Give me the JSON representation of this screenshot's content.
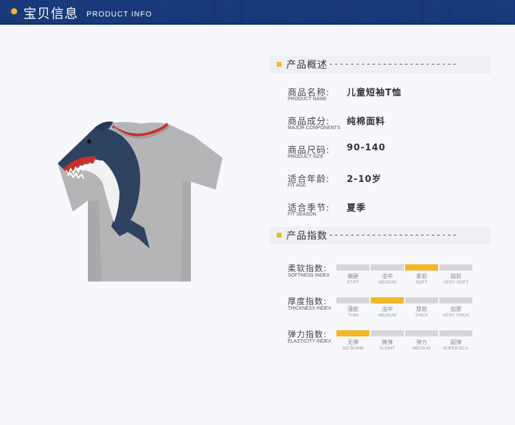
{
  "header": {
    "title": "宝贝信息",
    "subtitle": "PRODUCT INFO"
  },
  "colors": {
    "header_bg": "#14367a",
    "accent": "#f5b525",
    "shirt": "#b4b4b6",
    "shark": "#2e4360"
  },
  "overview": {
    "title": "产品概述",
    "dashes": "------------------------",
    "rows": [
      {
        "label": "商品名称:",
        "sub": "PRODUCT NAME",
        "value": "儿童短袖T恤"
      },
      {
        "label": "商品成分:",
        "sub": "MAJOR COMPONENTS",
        "value": "纯棉面料"
      },
      {
        "label": "商品尺码:",
        "sub": "PRODUCT SIZE",
        "value": "90-140"
      },
      {
        "label": "适合年龄:",
        "sub": "FIT AGE",
        "value": "2-10岁"
      },
      {
        "label": "适合季节:",
        "sub": "FIT SEASON",
        "value": "夏季"
      }
    ]
  },
  "indices": {
    "title": "产品指数",
    "dashes": "------------------------",
    "rows": [
      {
        "label": "柔软指数:",
        "sub": "SOFTNESS INDEX",
        "selected": 2,
        "options": [
          {
            "cn": "偏硬",
            "en": "STIFF"
          },
          {
            "cn": "适中",
            "en": "MEDIUM"
          },
          {
            "cn": "柔软",
            "en": "SOFT"
          },
          {
            "cn": "超软",
            "en": "VERY SOFT"
          }
        ]
      },
      {
        "label": "厚度指数:",
        "sub": "THICKNESS INDEX",
        "selected": 1,
        "options": [
          {
            "cn": "薄款",
            "en": "THIN"
          },
          {
            "cn": "适中",
            "en": "MEDIUM"
          },
          {
            "cn": "厚款",
            "en": "THICK"
          },
          {
            "cn": "加厚",
            "en": "VERY THICK"
          }
        ]
      },
      {
        "label": "弹力指数:",
        "sub": "ELASTICITY INDEX",
        "selected": 0,
        "options": [
          {
            "cn": "无弹",
            "en": "NO BOMB"
          },
          {
            "cn": "微弹",
            "en": "SLIGHT"
          },
          {
            "cn": "弹力",
            "en": "MEDIUM"
          },
          {
            "cn": "超弹",
            "en": "SUPER ELA."
          }
        ]
      }
    ]
  }
}
